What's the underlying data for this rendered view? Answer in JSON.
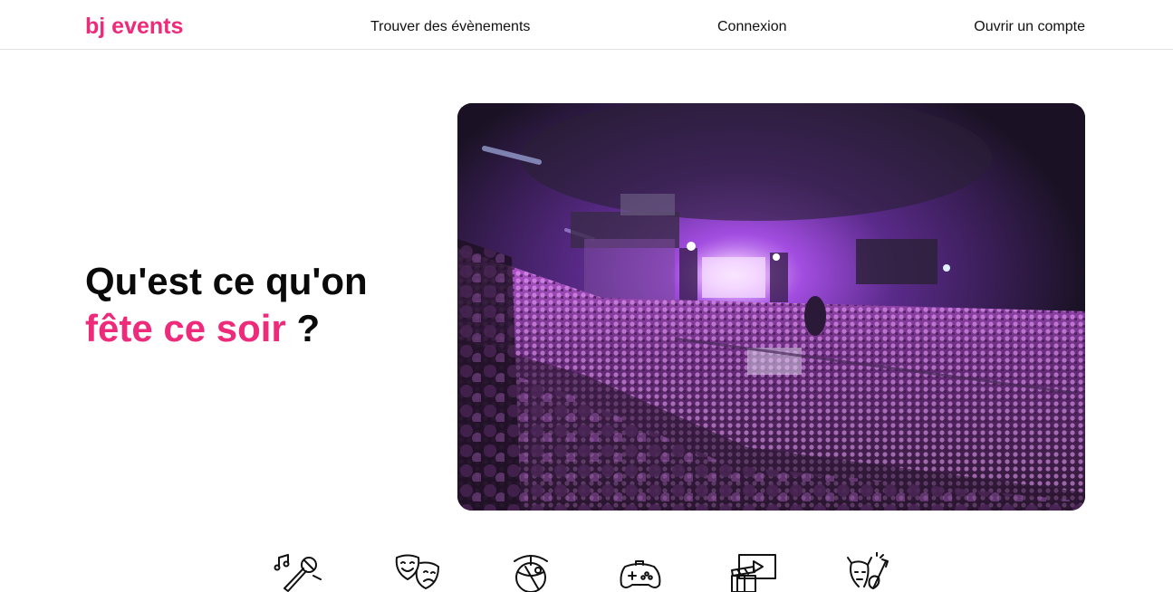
{
  "brand": {
    "name": "bj events",
    "color": "#ee2a7b"
  },
  "nav": {
    "find_events": "Trouver des évènements",
    "login": "Connexion",
    "signup": "Ouvrir un compte"
  },
  "hero": {
    "title_part1": "Qu'est ce qu'on ",
    "title_accent": "fête ce soir",
    "title_part2": " ?",
    "image": "concert-crowd-photo"
  },
  "categories": [
    {
      "icon": "karaoke-icon"
    },
    {
      "icon": "theater-masks-icon"
    },
    {
      "icon": "cocktail-party-icon"
    },
    {
      "icon": "gamepad-icon"
    },
    {
      "icon": "cinema-icon"
    },
    {
      "icon": "rock-concert-icon"
    }
  ]
}
